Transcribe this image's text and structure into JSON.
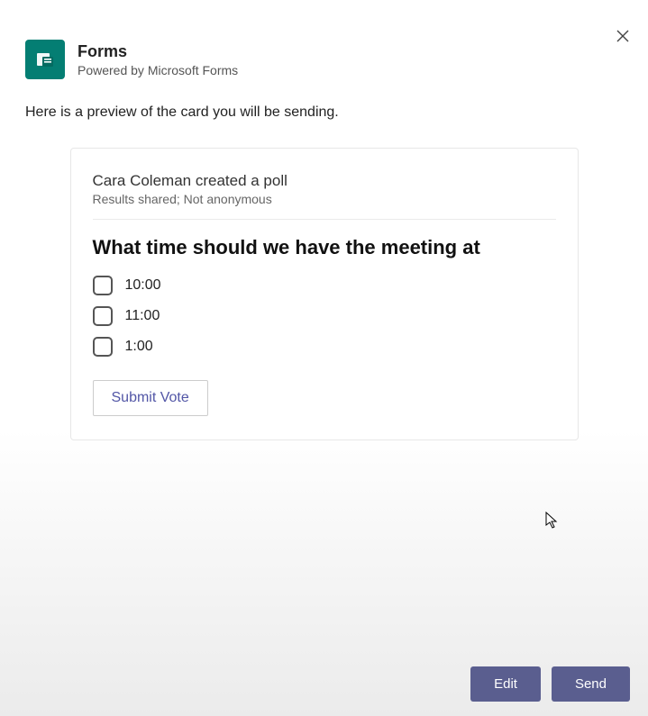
{
  "header": {
    "title": "Forms",
    "subtitle": "Powered by Microsoft Forms"
  },
  "preview_intro": "Here is a preview of the card you will be sending.",
  "poll": {
    "author_line": "Cara Coleman created a poll",
    "meta": "Results shared; Not anonymous",
    "question": "What time should we have the meeting at",
    "options": [
      "10:00",
      "11:00",
      "1:00"
    ],
    "submit_label": "Submit Vote"
  },
  "footer": {
    "edit_label": "Edit",
    "send_label": "Send"
  }
}
